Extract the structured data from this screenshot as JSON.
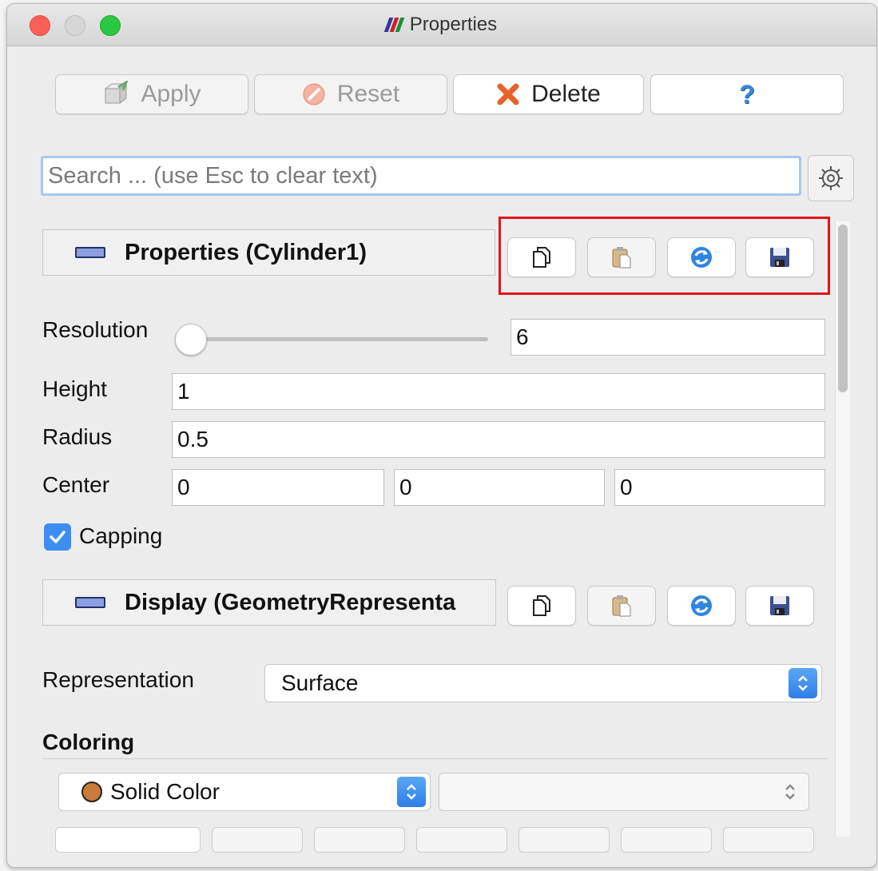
{
  "window": {
    "title": "Properties"
  },
  "toolbar": {
    "apply_label": "Apply",
    "reset_label": "Reset",
    "delete_label": "Delete",
    "help_label": "?"
  },
  "search": {
    "placeholder": "Search ... (use Esc to clear text)",
    "value": ""
  },
  "properties_section": {
    "title": "Properties (Cylinder1)"
  },
  "fields": {
    "resolution": {
      "label": "Resolution",
      "value": "6"
    },
    "height": {
      "label": "Height",
      "value": "1"
    },
    "radius": {
      "label": "Radius",
      "value": "0.5"
    },
    "center": {
      "label": "Center",
      "x": "0",
      "y": "0",
      "z": "0"
    },
    "capping": {
      "label": "Capping",
      "checked": true
    }
  },
  "display_section": {
    "title": "Display (GeometryRepresenta"
  },
  "representation": {
    "label": "Representation",
    "value": "Surface"
  },
  "coloring": {
    "title": "Coloring",
    "mode": "Solid Color",
    "swatch_color": "#c87b3a",
    "array": ""
  },
  "colors": {
    "accent": "#3d8ef0",
    "highlight_box": "#e0141b"
  },
  "icons": [
    "apply-icon",
    "reset-icon",
    "delete-icon",
    "help-icon",
    "gear-icon",
    "copy-icon",
    "paste-icon",
    "reload-icon",
    "save-icon"
  ]
}
